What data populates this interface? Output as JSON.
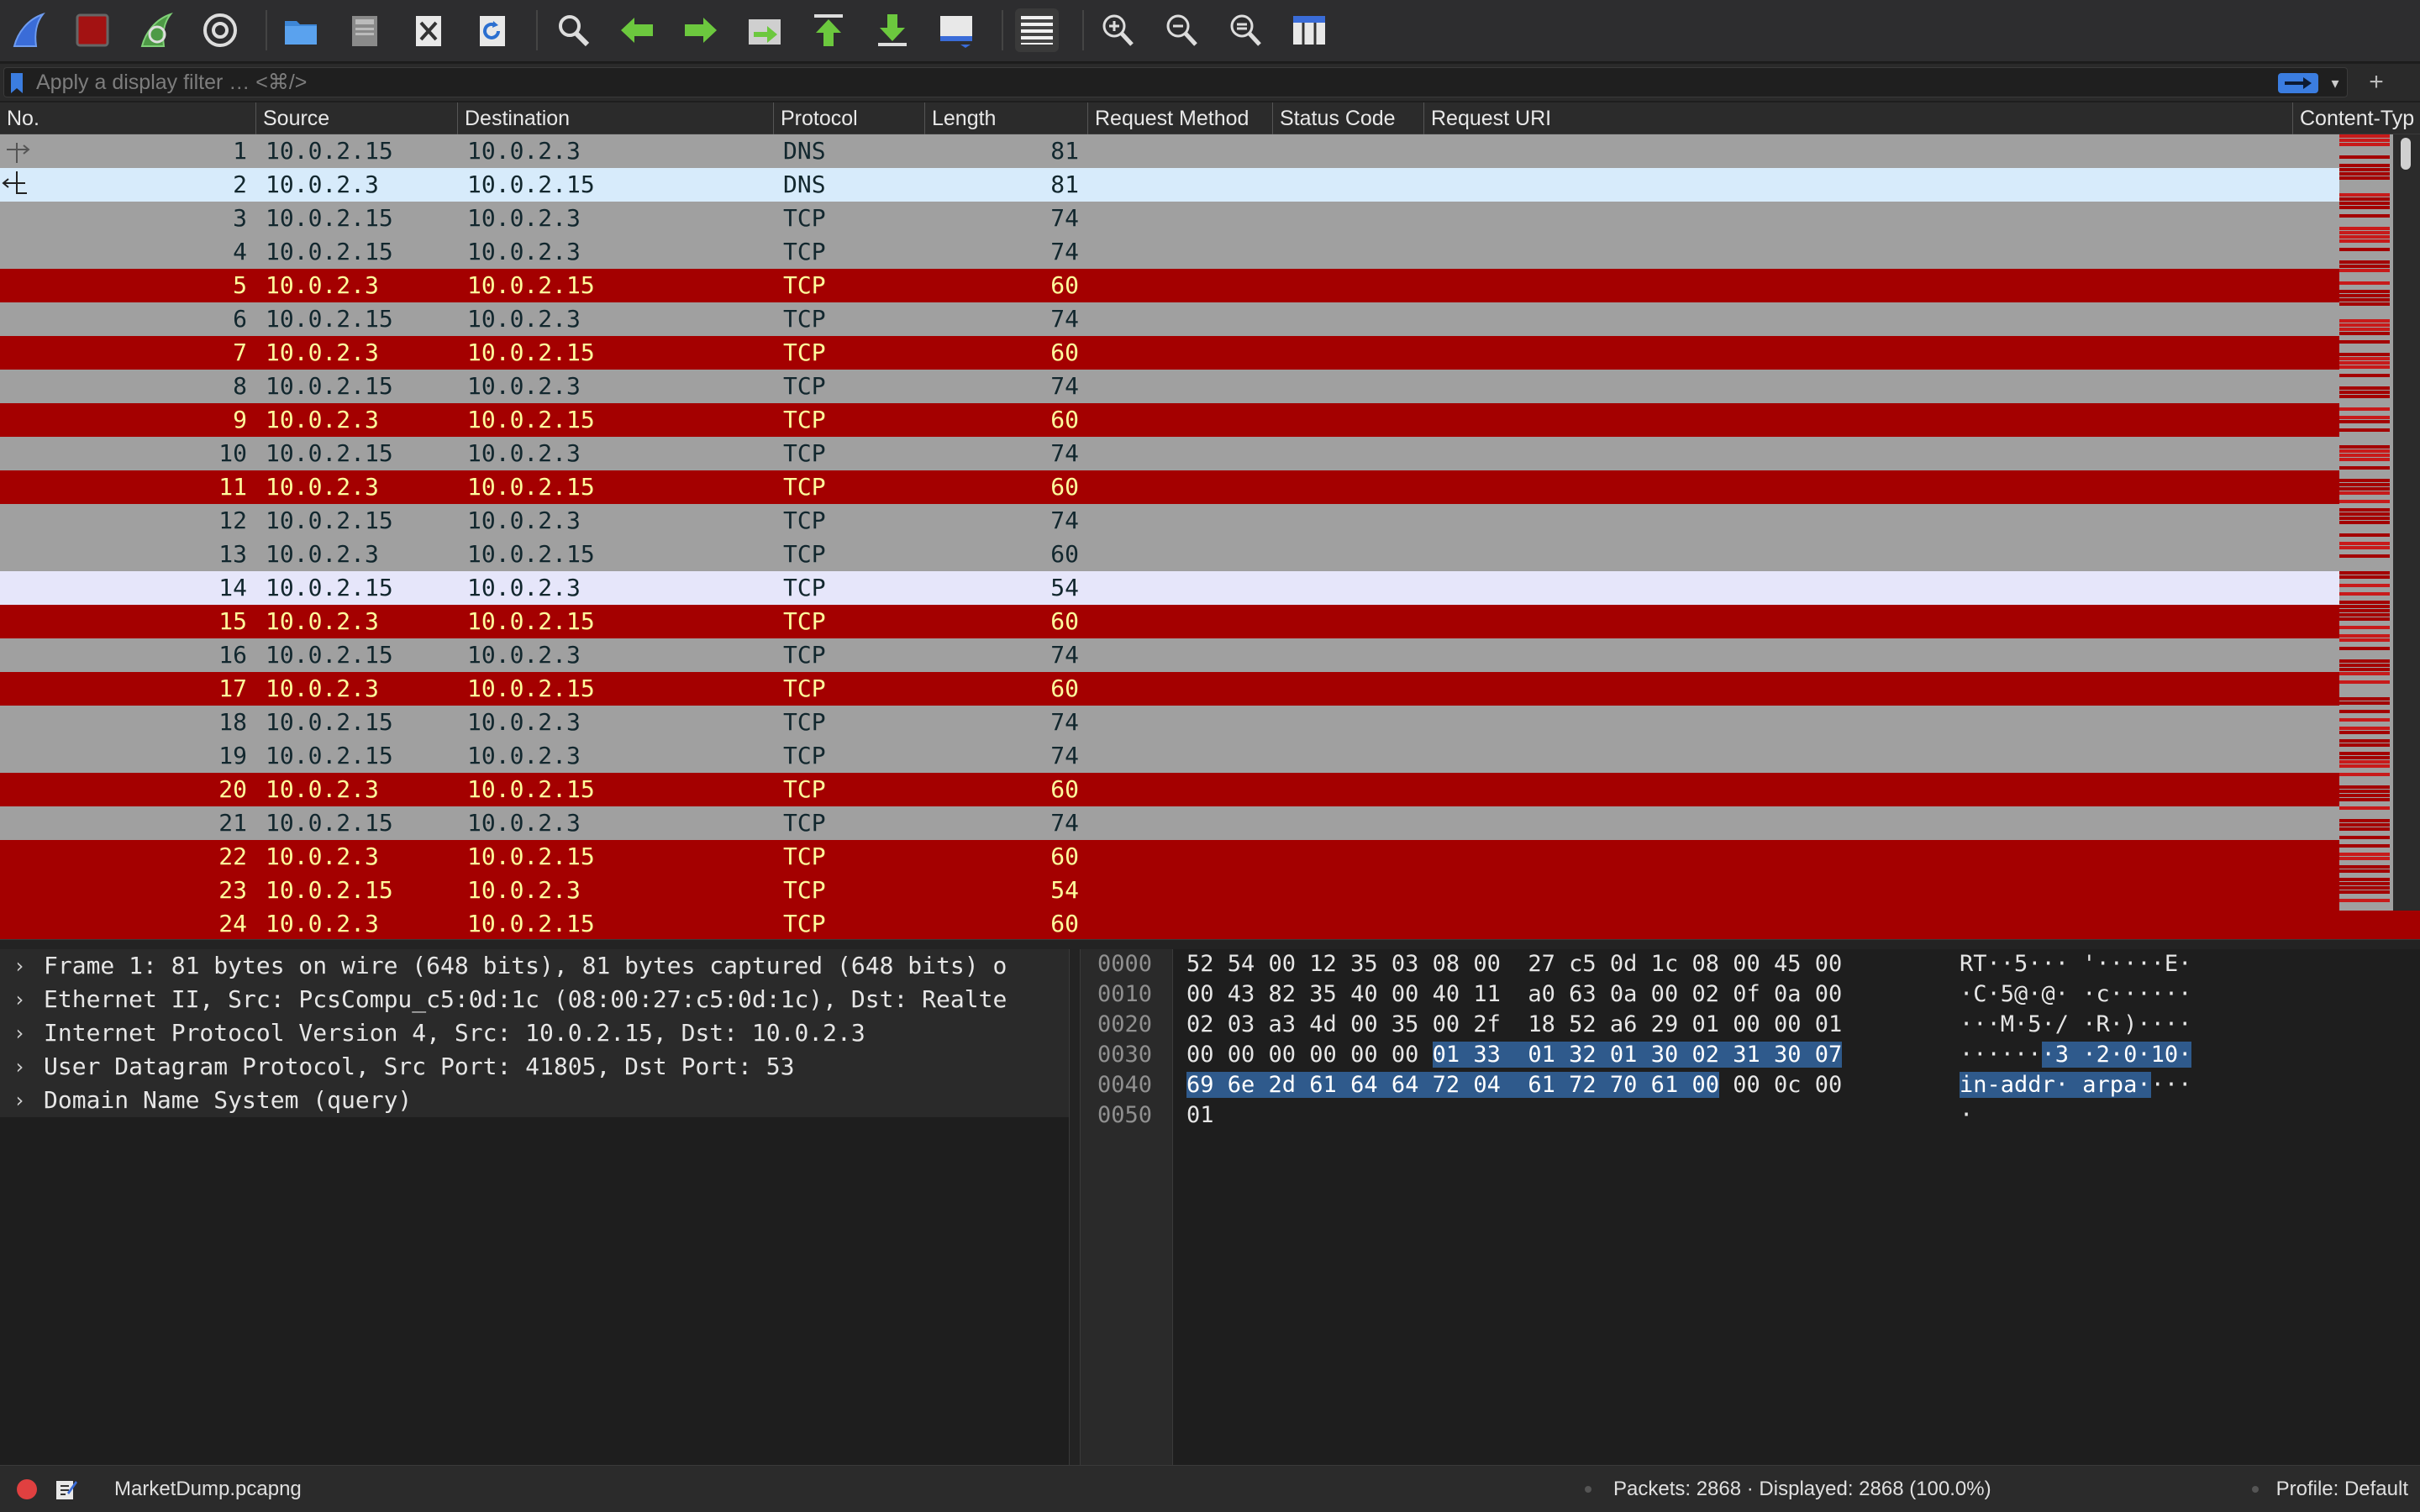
{
  "filter": {
    "placeholder": "Apply a display filter … <⌘/>"
  },
  "columns": [
    "No.",
    "Source",
    "Destination",
    "Protocol",
    "Length",
    "Request Method",
    "Status Code",
    "Request URI",
    "Content-Typ"
  ],
  "packets": [
    {
      "no": "1",
      "src": "10.0.2.15",
      "dst": "10.0.2.3",
      "proto": "DNS",
      "len": "81",
      "color": "gray"
    },
    {
      "no": "2",
      "src": "10.0.2.3",
      "dst": "10.0.2.15",
      "proto": "DNS",
      "len": "81",
      "color": "sel"
    },
    {
      "no": "3",
      "src": "10.0.2.15",
      "dst": "10.0.2.3",
      "proto": "TCP",
      "len": "74",
      "color": "gray"
    },
    {
      "no": "4",
      "src": "10.0.2.15",
      "dst": "10.0.2.3",
      "proto": "TCP",
      "len": "74",
      "color": "gray"
    },
    {
      "no": "5",
      "src": "10.0.2.3",
      "dst": "10.0.2.15",
      "proto": "TCP",
      "len": "60",
      "color": "red"
    },
    {
      "no": "6",
      "src": "10.0.2.15",
      "dst": "10.0.2.3",
      "proto": "TCP",
      "len": "74",
      "color": "gray"
    },
    {
      "no": "7",
      "src": "10.0.2.3",
      "dst": "10.0.2.15",
      "proto": "TCP",
      "len": "60",
      "color": "red"
    },
    {
      "no": "8",
      "src": "10.0.2.15",
      "dst": "10.0.2.3",
      "proto": "TCP",
      "len": "74",
      "color": "gray"
    },
    {
      "no": "9",
      "src": "10.0.2.3",
      "dst": "10.0.2.15",
      "proto": "TCP",
      "len": "60",
      "color": "red"
    },
    {
      "no": "10",
      "src": "10.0.2.15",
      "dst": "10.0.2.3",
      "proto": "TCP",
      "len": "74",
      "color": "gray"
    },
    {
      "no": "11",
      "src": "10.0.2.3",
      "dst": "10.0.2.15",
      "proto": "TCP",
      "len": "60",
      "color": "red"
    },
    {
      "no": "12",
      "src": "10.0.2.15",
      "dst": "10.0.2.3",
      "proto": "TCP",
      "len": "74",
      "color": "gray"
    },
    {
      "no": "13",
      "src": "10.0.2.3",
      "dst": "10.0.2.15",
      "proto": "TCP",
      "len": "60",
      "color": "gray"
    },
    {
      "no": "14",
      "src": "10.0.2.15",
      "dst": "10.0.2.3",
      "proto": "TCP",
      "len": "54",
      "color": "light"
    },
    {
      "no": "15",
      "src": "10.0.2.3",
      "dst": "10.0.2.15",
      "proto": "TCP",
      "len": "60",
      "color": "red"
    },
    {
      "no": "16",
      "src": "10.0.2.15",
      "dst": "10.0.2.3",
      "proto": "TCP",
      "len": "74",
      "color": "gray"
    },
    {
      "no": "17",
      "src": "10.0.2.3",
      "dst": "10.0.2.15",
      "proto": "TCP",
      "len": "60",
      "color": "red"
    },
    {
      "no": "18",
      "src": "10.0.2.15",
      "dst": "10.0.2.3",
      "proto": "TCP",
      "len": "74",
      "color": "gray"
    },
    {
      "no": "19",
      "src": "10.0.2.15",
      "dst": "10.0.2.3",
      "proto": "TCP",
      "len": "74",
      "color": "gray"
    },
    {
      "no": "20",
      "src": "10.0.2.3",
      "dst": "10.0.2.15",
      "proto": "TCP",
      "len": "60",
      "color": "red"
    },
    {
      "no": "21",
      "src": "10.0.2.15",
      "dst": "10.0.2.3",
      "proto": "TCP",
      "len": "74",
      "color": "gray"
    },
    {
      "no": "22",
      "src": "10.0.2.3",
      "dst": "10.0.2.15",
      "proto": "TCP",
      "len": "60",
      "color": "red"
    },
    {
      "no": "23",
      "src": "10.0.2.15",
      "dst": "10.0.2.3",
      "proto": "TCP",
      "len": "54",
      "color": "red"
    },
    {
      "no": "24",
      "src": "10.0.2.3",
      "dst": "10.0.2.15",
      "proto": "TCP",
      "len": "60",
      "color": "red"
    }
  ],
  "details": [
    "Frame 1: 81 bytes on wire (648 bits), 81 bytes captured (648 bits) o",
    "Ethernet II, Src: PcsCompu_c5:0d:1c (08:00:27:c5:0d:1c), Dst: Realte",
    "Internet Protocol Version 4, Src: 10.0.2.15, Dst: 10.0.2.3",
    "User Datagram Protocol, Src Port: 41805, Dst Port: 53",
    "Domain Name System (query)"
  ],
  "bytes": [
    {
      "off": "0000",
      "hex_a": "52 54 00 12 35 03 08 00  27 c5 0d 1c 08 00 45 00",
      "hex_hl": "",
      "hex_b": "",
      "asc_a": "RT··5··· '·····E·",
      "asc_hl": "",
      "asc_b": ""
    },
    {
      "off": "0010",
      "hex_a": "00 43 82 35 40 00 40 11  a0 63 0a 00 02 0f 0a 00",
      "hex_hl": "",
      "hex_b": "",
      "asc_a": "·C·5@·@· ·c······",
      "asc_hl": "",
      "asc_b": ""
    },
    {
      "off": "0020",
      "hex_a": "02 03 a3 4d 00 35 00 2f  18 52 a6 29 01 00 00 01",
      "hex_hl": "",
      "hex_b": "",
      "asc_a": "···M·5·/ ·R·)····",
      "asc_hl": "",
      "asc_b": ""
    },
    {
      "off": "0030",
      "hex_a": "00 00 00 00 00 00 ",
      "hex_hl": "01 33  01 32 01 30 02 31 30 07",
      "hex_b": "",
      "asc_a": "······",
      "asc_hl": "·3 ·2·0·10·",
      "asc_b": ""
    },
    {
      "off": "0040",
      "hex_a": "",
      "hex_hl": "69 6e 2d 61 64 64 72 04  61 72 70 61 00",
      "hex_b": " 00 0c 00",
      "asc_a": "",
      "asc_hl": "in-addr· arpa·",
      "asc_b": "···"
    },
    {
      "off": "0050",
      "hex_a": "01",
      "hex_hl": "",
      "hex_b": "",
      "asc_a": "·",
      "asc_hl": "",
      "asc_b": ""
    }
  ],
  "status": {
    "file": "MarketDump.pcapng",
    "packets": "Packets: 2868 · Displayed: 2868 (100.0%)",
    "profile": "Profile: Default"
  },
  "colors": {
    "tcp_error_bg": "#a40000",
    "tcp_error_fg": "#fffc9c",
    "gray_bg": "#a0a0a0",
    "selected_bg": "#d7ebfb",
    "highlight_bytes": "#2f5a8c"
  }
}
